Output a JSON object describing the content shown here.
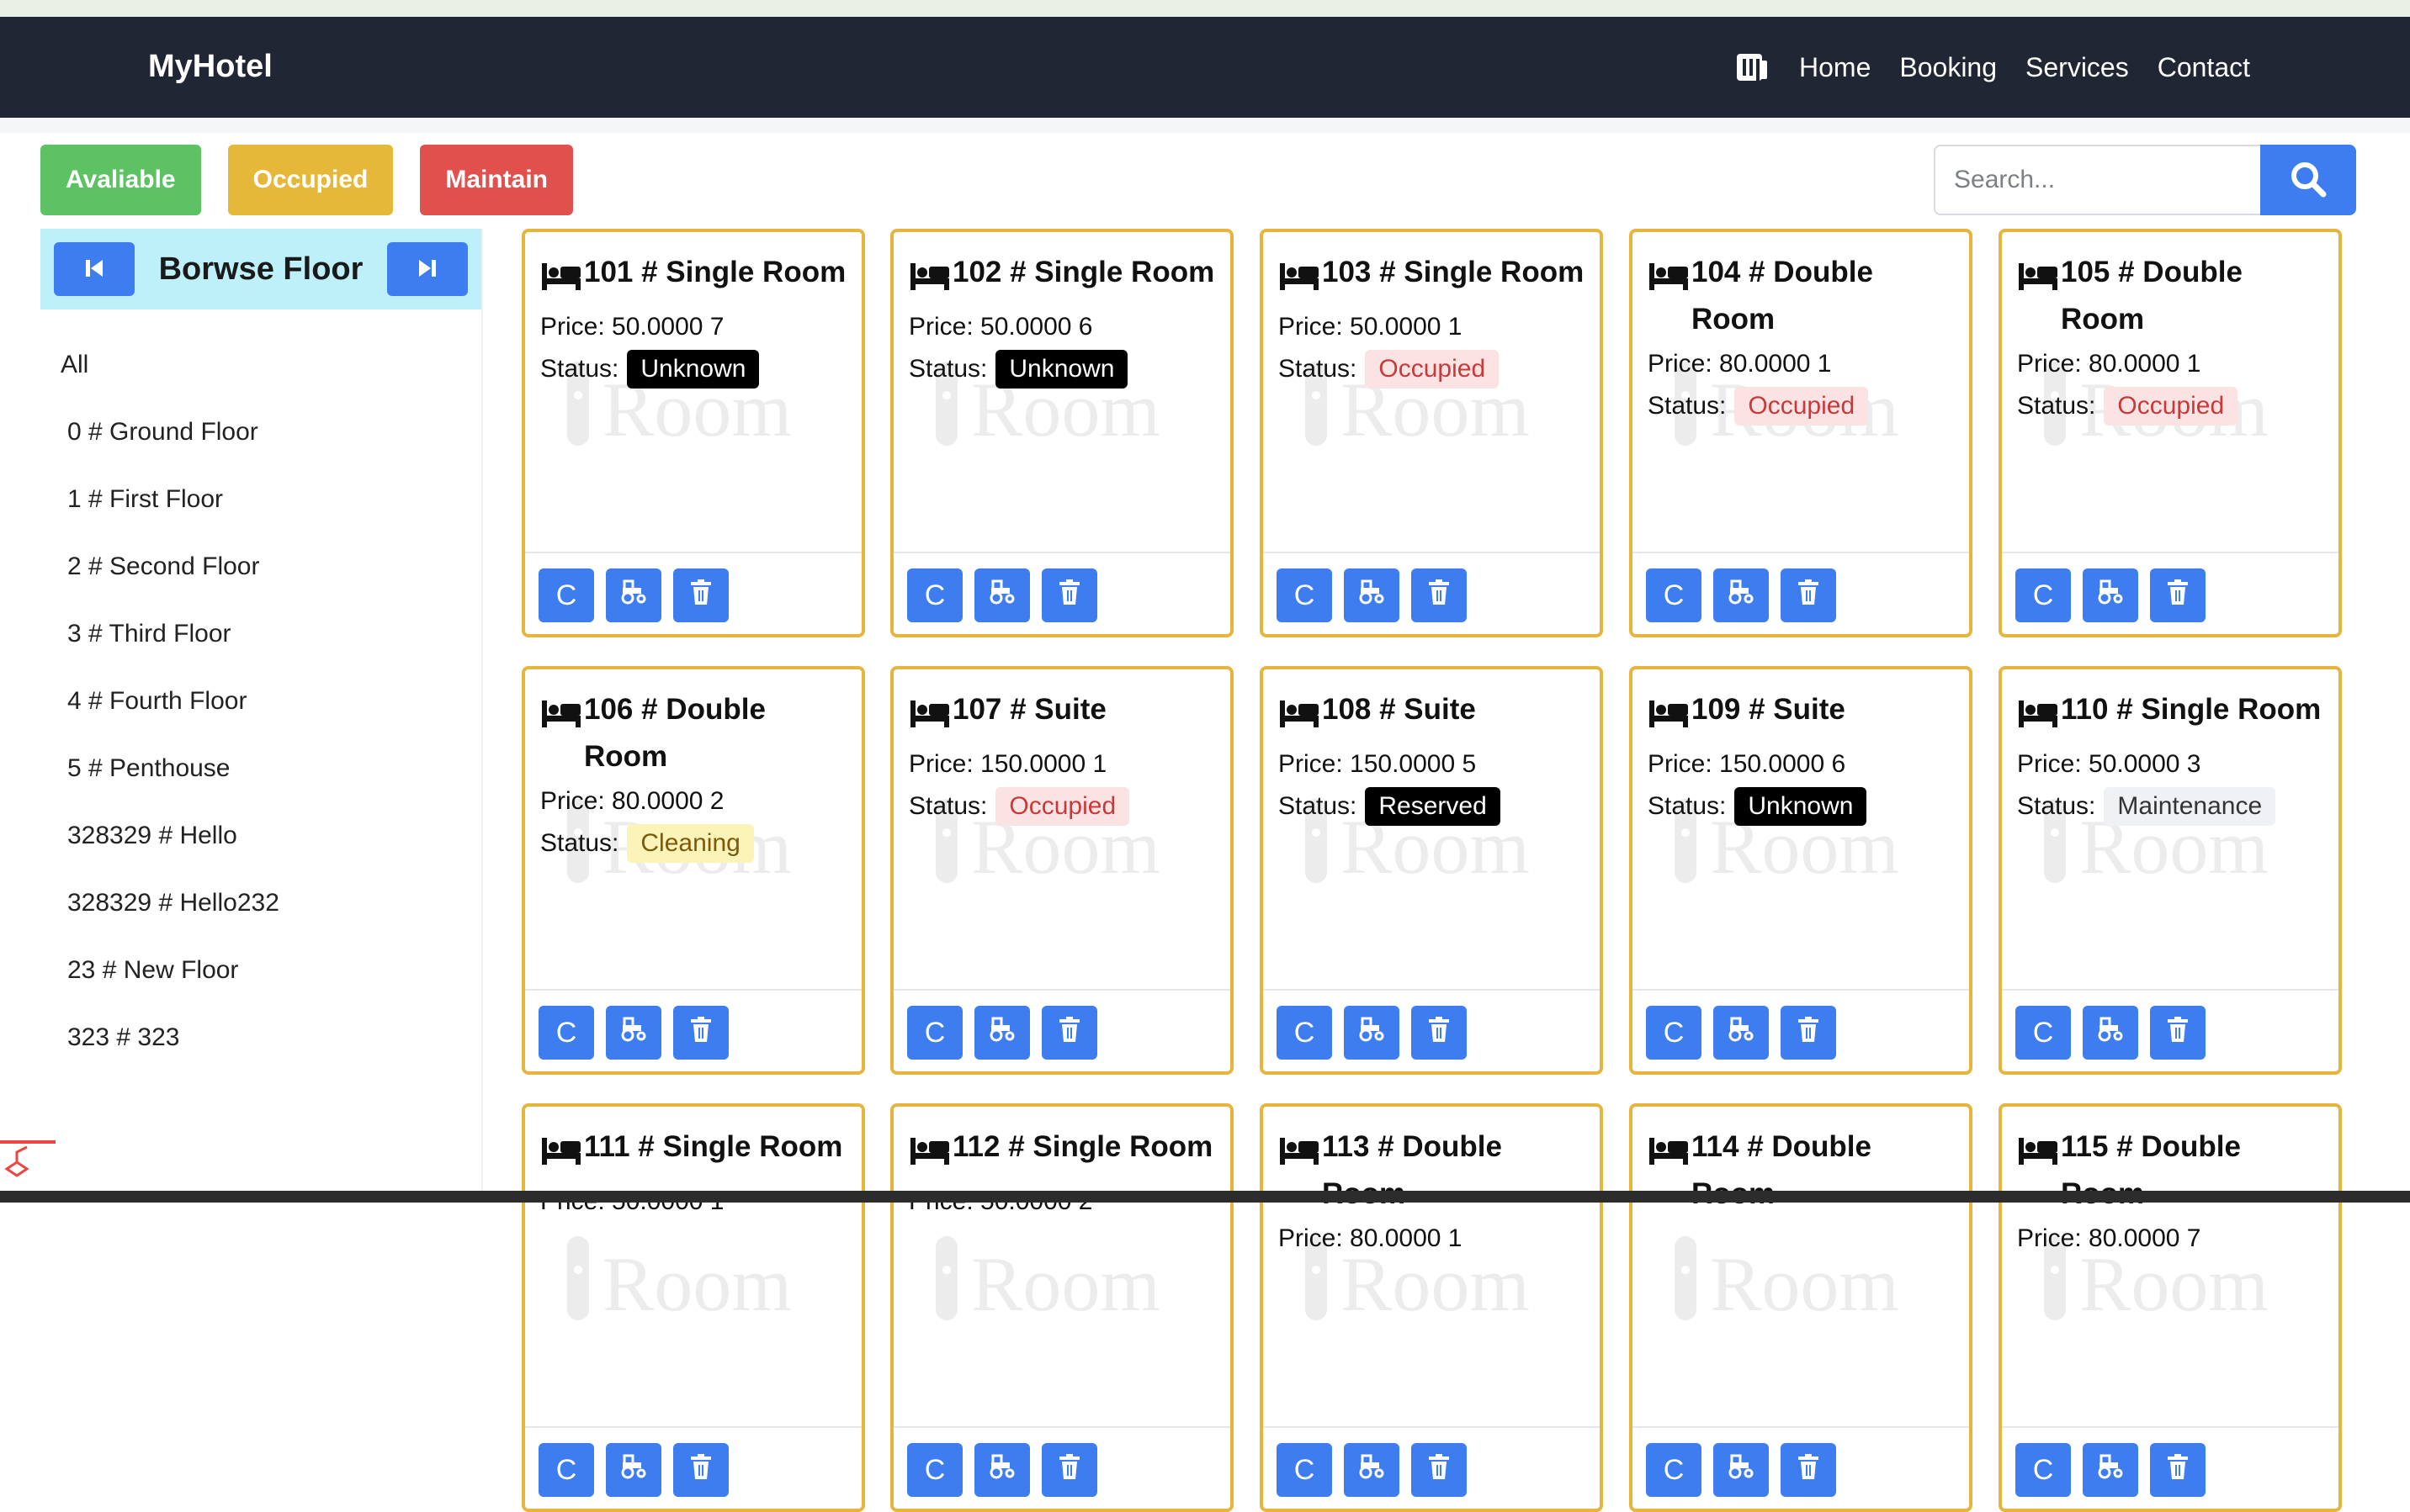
{
  "brand": "MyHotel",
  "nav": {
    "links": [
      "Home",
      "Booking",
      "Services",
      "Contact"
    ]
  },
  "filters": {
    "available": "Avaliable",
    "occupied": "Occupied",
    "maintain": "Maintain"
  },
  "search": {
    "placeholder": "Search..."
  },
  "sidebar": {
    "title": "Borwse Floor",
    "floors": [
      "All",
      "0 # Ground Floor",
      "1 # First Floor",
      "2 # Second Floor",
      "3 # Third Floor",
      "4 # Fourth Floor",
      "5 # Penthouse",
      "328329 # Hello",
      "328329 # Hello232",
      "23 # New Floor",
      "323 # 323"
    ]
  },
  "labels": {
    "price": "Price:",
    "status": "Status:"
  },
  "watermark": "Room",
  "rooms": [
    {
      "title": "101 # Single Room",
      "price": "50.0000 7",
      "status": "Unknown",
      "kind": "unknown"
    },
    {
      "title": "102 # Single Room",
      "price": "50.0000 6",
      "status": "Unknown",
      "kind": "unknown"
    },
    {
      "title": "103 # Single Room",
      "price": "50.0000 1",
      "status": "Occupied",
      "kind": "occupied"
    },
    {
      "title_lines": [
        "104 # Double",
        "Room"
      ],
      "price": "80.0000 1",
      "status": "Occupied",
      "kind": "occupied"
    },
    {
      "title_lines": [
        "105 # Double",
        "Room"
      ],
      "price": "80.0000 1",
      "status": "Occupied",
      "kind": "occupied"
    },
    {
      "title_lines": [
        "106 # Double",
        "Room"
      ],
      "price": "80.0000 2",
      "status": "Cleaning",
      "kind": "cleaning"
    },
    {
      "title": "107 # Suite",
      "price": "150.0000 1",
      "status": "Occupied",
      "kind": "occupied"
    },
    {
      "title": "108 # Suite",
      "price": "150.0000 5",
      "status": "Reserved",
      "kind": "reserved"
    },
    {
      "title": "109 # Suite",
      "price": "150.0000 6",
      "status": "Unknown",
      "kind": "unknown"
    },
    {
      "title": "110 # Single Room",
      "price": "50.0000 3",
      "status": "Maintenance",
      "kind": "maintenance"
    },
    {
      "title": "111 # Single Room",
      "price": "50.0000 1"
    },
    {
      "title": "112 # Single Room",
      "price": "50.0000 2"
    },
    {
      "title": "113 # Double Room",
      "price": "80.0000 1"
    },
    {
      "title_lines": [
        "114 # Double",
        "Room"
      ]
    },
    {
      "title": "115 # Double Room",
      "price": "80.0000 7"
    }
  ],
  "actions": {
    "refresh_label": "C",
    "icons": [
      "refresh-icon",
      "tractor-icon",
      "trash-icon"
    ]
  },
  "colors": {
    "navbar": "#212634",
    "available": "#5cc263",
    "occupied": "#e6b83a",
    "maintain": "#e0504c",
    "primary": "#3d7df0",
    "card_border": "#e7b43d",
    "sidebar_head": "#bdf0f8"
  }
}
